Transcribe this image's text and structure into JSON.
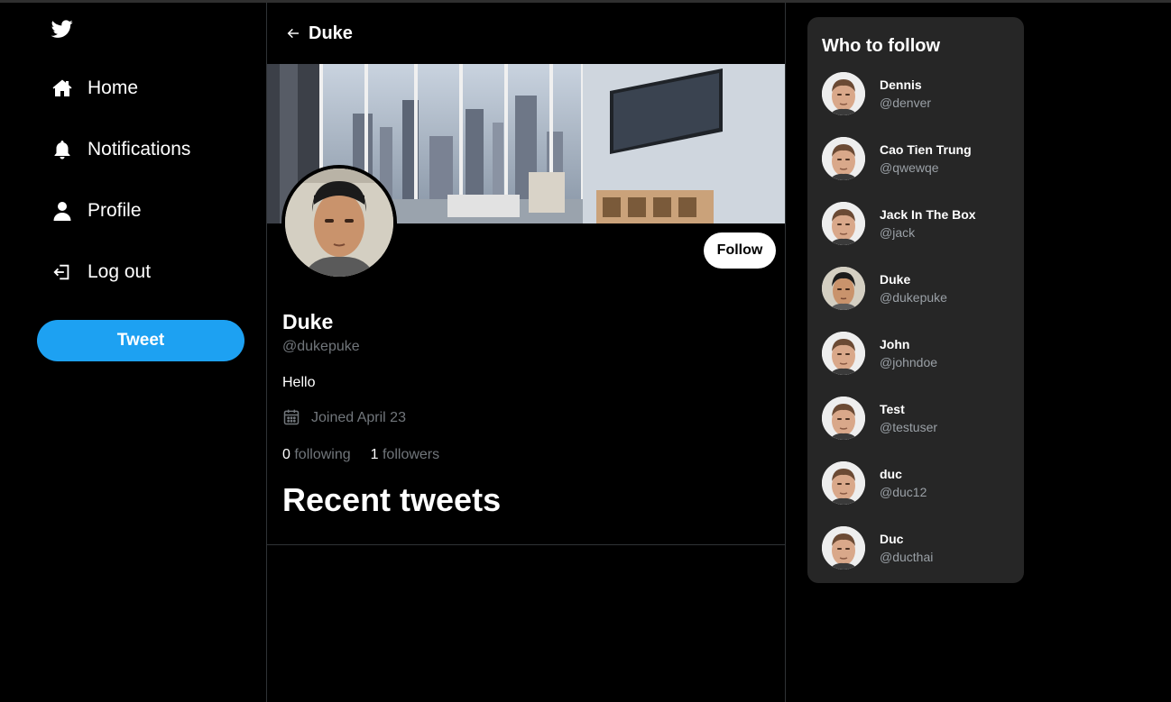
{
  "nav": {
    "items": [
      {
        "label": "Home",
        "icon": "home-icon"
      },
      {
        "label": "Notifications",
        "icon": "bell-icon"
      },
      {
        "label": "Profile",
        "icon": "person-icon"
      },
      {
        "label": "Log out",
        "icon": "logout-icon"
      }
    ],
    "tweet_label": "Tweet"
  },
  "header": {
    "title": "Duke"
  },
  "profile": {
    "name": "Duke",
    "handle": "@dukepuke",
    "bio": "Hello",
    "joined": "Joined April 23",
    "following_count": "0",
    "following_label": "following",
    "followers_count": "1",
    "followers_label": "followers",
    "follow_label": "Follow"
  },
  "recent_tweets_title": "Recent tweets",
  "who_to_follow": {
    "title": "Who to follow",
    "users": [
      {
        "name": "Dennis",
        "handle": "@denver"
      },
      {
        "name": "Cao Tien Trung",
        "handle": "@qwewqe"
      },
      {
        "name": "Jack In The Box",
        "handle": "@jack"
      },
      {
        "name": "Duke",
        "handle": "@dukepuke"
      },
      {
        "name": "John",
        "handle": "@johndoe"
      },
      {
        "name": "Test",
        "handle": "@testuser"
      },
      {
        "name": "duc",
        "handle": "@duc12"
      },
      {
        "name": "Duc",
        "handle": "@ducthai"
      }
    ]
  },
  "colors": {
    "accent": "#1da1f2",
    "background": "#000000",
    "panel": "#262626",
    "muted_text": "#71767b"
  }
}
